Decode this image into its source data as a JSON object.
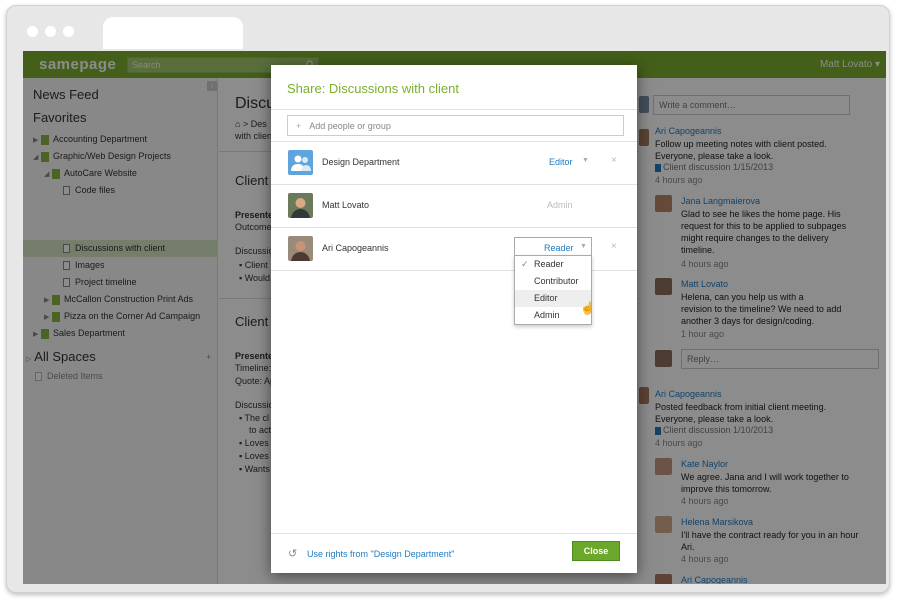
{
  "app": {
    "logo": "samepage",
    "search_placeholder": "Search",
    "user": "Matt Lovato ▾"
  },
  "sidebar": {
    "news_feed": "News Feed",
    "favorites": "Favorites",
    "items": [
      "Accounting Department",
      "Graphic/Web Design Projects",
      "AutoCare Website",
      "Code files",
      "Discussions with client",
      "Images",
      "Project timeline",
      "McCallon Construction Print Ads",
      "Pizza on the Corner Ad Campaign",
      "Sales Department"
    ],
    "all_spaces": "All Spaces",
    "deleted_items": "Deleted Items"
  },
  "main": {
    "title": "Discu",
    "crumb_1": "Des",
    "crumb_2": "with clien",
    "section_1_title": "Client",
    "present_1": "Presente",
    "outcome": "Outcome",
    "discussion_1": "Discussio",
    "bullet_1a": "Client",
    "bullet_1b": "Would",
    "section_2_title": "Client",
    "present_2": "Presente",
    "timeline": "Timeline:",
    "quote": "Quote: Ap",
    "discussion_2": "Discussio",
    "bullet_2a": "The cl",
    "bullet_2b": "to acti",
    "bullet_2c": "Loves",
    "bullet_2d": "Loves",
    "bullet_2e": "Wants"
  },
  "feed": {
    "comment_placeholder": "Write a comment…",
    "reply_placeholder": "Reply…",
    "posts": [
      {
        "name": "Ari Capogeannis",
        "line1": "Follow up meeting notes with client posted.",
        "line2": "Everyone, please take a look.",
        "file": "Client discussion 1/15/2013",
        "time": "4 hours ago"
      },
      {
        "name": "Jana Langmaierova",
        "line1": "Glad to see he likes the home page. His",
        "line2": "request for this to be applied to subpages",
        "line3": "might require changes to the delivery",
        "line4": "timeline.",
        "time": "4 hours ago"
      },
      {
        "name": "Matt Lovato",
        "line1": "Helena, can you help us with a",
        "line2": "revision to the timeline? We need to add",
        "line3": "another 3 days for design/coding.",
        "time": "1 hour ago"
      },
      {
        "name": "Ari Capogeannis",
        "line1": "Posted feedback from initial client meeting.",
        "line2": "Everyone, please take a look.",
        "file": "Client discussion 1/10/2013",
        "time": "4 hours ago"
      },
      {
        "name": "Kate Naylor",
        "line1": "We agree. Jana and I will work together to",
        "line2": "improve this tomorrow.",
        "time": "4 hours ago"
      },
      {
        "name": "Helena Marsikova",
        "line1": "I'll have the contract ready for you in an hour",
        "line2": "Ari.",
        "time": "4 hours ago"
      },
      {
        "name": "Ari Capogeannis"
      }
    ]
  },
  "modal": {
    "title": "Share: Discussions with client",
    "add_placeholder": "Add people or group",
    "members": [
      {
        "name": "Design Department",
        "role": "Editor"
      },
      {
        "name": "Matt Lovato",
        "role": "Admin"
      },
      {
        "name": "Ari Capogeannis",
        "role": "Reader"
      }
    ],
    "role_options": [
      "Reader",
      "Contributor",
      "Editor",
      "Admin"
    ],
    "use_rights": "Use rights from \"Design Department\"",
    "close": "Close"
  },
  "colors": {
    "brand": "#7cad2f",
    "link": "#1f7bc2",
    "close_button": "#6aa72a"
  }
}
